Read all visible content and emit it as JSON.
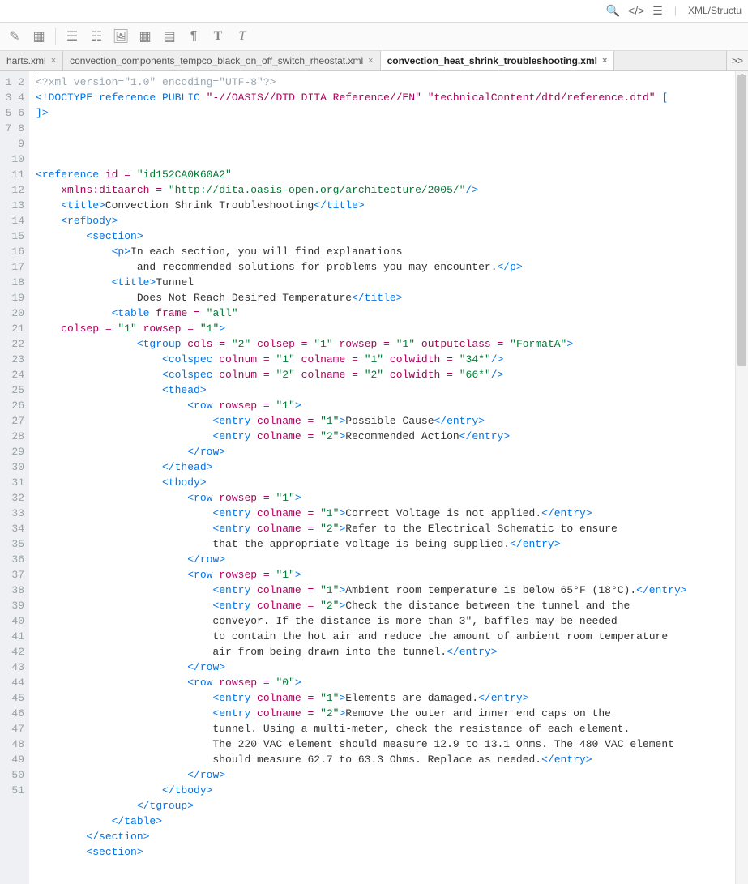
{
  "topbar": {
    "breadcrumb": "XML/Structu"
  },
  "tabs": [
    {
      "label": "harts.xml",
      "close": "×"
    },
    {
      "label": "convection_components_tempco_black_on_off_switch_rheostat.xml",
      "close": "×"
    },
    {
      "label": "convection_heat_shrink_troubleshooting.xml",
      "close": "×"
    }
  ],
  "more_tabs": ">>",
  "gutter_start": 1,
  "gutter_end": 51,
  "code": {
    "t1": "<?xml version=\"1.0\" encoding=\"UTF-8\"?>",
    "doctype_kw": "<!DOCTYPE",
    "doctype_rest1": " reference PUBLIC ",
    "doctype_str1": "\"-//OASIS//DTD DITA Reference//EN\"",
    "doctype_str2": "\"technicalContent/dtd/reference.dtd\"",
    "doctype_rest2": " [",
    "doctype_end": "]>",
    "ref_open": "<reference",
    "ref_id_attr": " id = ",
    "ref_id_val": "\"id152CA0K60A2\"",
    "ref_ns_attr": "    xmlns:ditaarch = ",
    "ref_ns_val": "\"http://dita.oasis-open.org/architecture/2005/\"",
    "close_slashgt": "/>",
    "gt": ">",
    "title_o": "<title>",
    "title_c": "</title>",
    "title_text": "Convection Shrink Troubleshooting",
    "refbody_o": "<refbody>",
    "section_o": "<section>",
    "p_o": "<p>",
    "p_c": "</p>",
    "p_text1": "In each section, you will find explanations",
    "p_text2": "                and recommended solutions for problems you may encounter.",
    "title2_text1": "Tunnel",
    "title2_text2": "                Does Not Reach Desired Temperature",
    "table_o": "<table",
    "table_attr1": " frame = ",
    "table_val1": "\"all\"",
    "table_attr_line2": "    colsep = ",
    "one": "\"1\"",
    "rowsep_attr": " rowsep = ",
    "tgroup_o": "<tgroup",
    "cols_attr": " cols = ",
    "two": "\"2\"",
    "colsep_attr": " colsep = ",
    "outputclass_attr": " outputclass = ",
    "formatA": "\"FormatA\"",
    "colspec_o": "<colspec",
    "colnum_attr": " colnum = ",
    "colname_attr": " colname = ",
    "colwidth_attr": " colwidth = ",
    "cw34": "\"34*\"",
    "cw66": "\"66*\"",
    "thead_o": "<thead>",
    "thead_c": "</thead>",
    "row_o": "<row",
    "row_c": "</row>",
    "entry_o": "<entry",
    "entry_c": "</entry>",
    "hdr1": "Possible Cause",
    "hdr2": "Recommended Action",
    "tbody_o": "<tbody>",
    "tbody_c": "</tbody>",
    "r1c1": "Correct Voltage is not applied.",
    "r1c2a": "Refer to the Electrical Schematic to ensure",
    "r1c2b": "                            that the appropriate voltage is being supplied.",
    "r2c1": "Ambient room temperature is below 65°F (18°C).",
    "r2c2a": "Check the distance between the tunnel and the",
    "r2c2b": "                            conveyor. If the distance is more than 3\", baffles may be needed",
    "r2c2c": "                            to contain the hot air and reduce the amount of ambient room temperature",
    "r2c2d": "                            air from being drawn into the tunnel.",
    "zero": "\"0\"",
    "r3c1": "Elements are damaged.",
    "r3c2a": "Remove the outer and inner end caps on the",
    "r3c2b": "                            tunnel. Using a multi-meter, check the resistance of each element.",
    "r3c2c": "                            The 220 VAC element should measure 12.9 to 13.1 Ohms. The 480 VAC element",
    "r3c2d": "                            should measure 62.7 to 63.3 Ohms. Replace as needed.",
    "tgroup_c": "</tgroup>",
    "table_c": "</table>",
    "section_c": "</section>"
  }
}
